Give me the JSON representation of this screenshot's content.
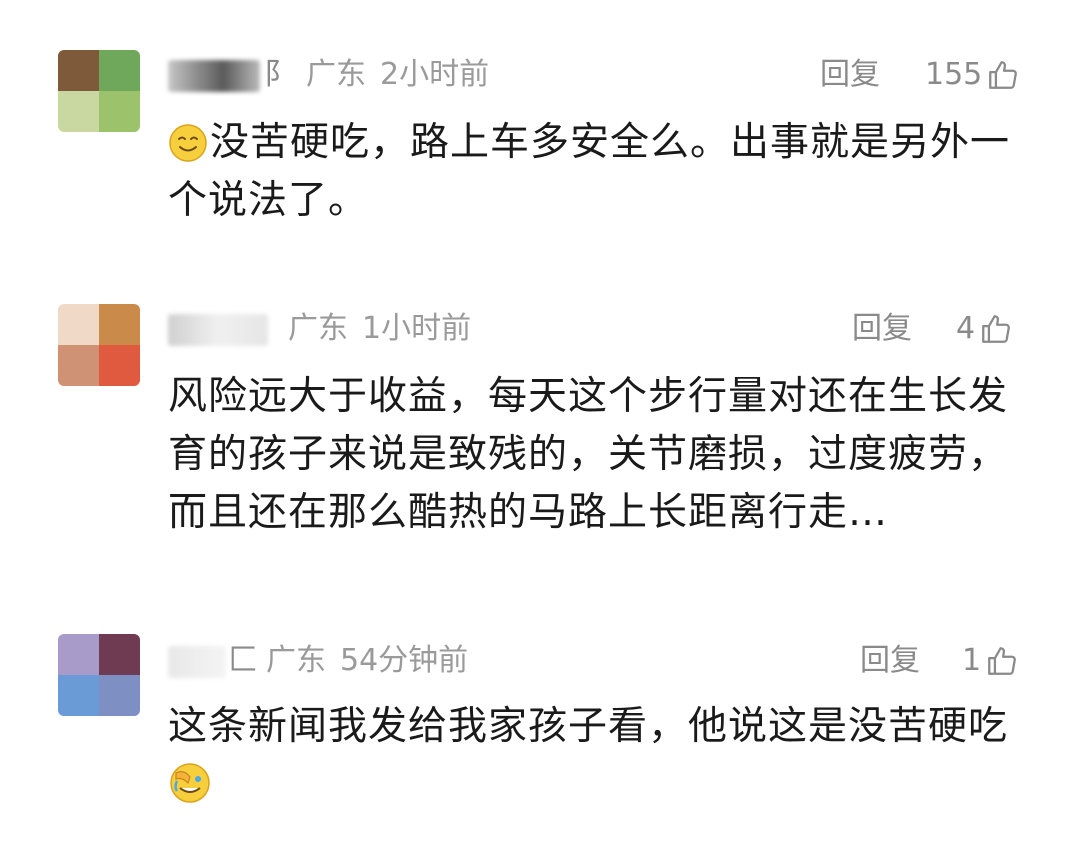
{
  "comments": [
    {
      "name_tail": "阝",
      "location": "广东",
      "time": "2小时前",
      "reply_label": "回复",
      "likes": "155",
      "text": "没苦硬吃，路上车多安全么。出事就是另外一个说法了。",
      "lead_emoji": "smile-emoji",
      "avatar_colors": [
        "#7f5a3a",
        "#6fa85a",
        "#c9d7a0",
        "#9cc36b"
      ]
    },
    {
      "name_tail": "",
      "location": "广东",
      "time": "1小时前",
      "reply_label": "回复",
      "likes": "4",
      "text": "风险远大于收益，每天这个步行量对还在生长发育的孩子来说是致残的，关节磨损，过度疲劳，而且还在那么酷热的马路上长距离行走…",
      "avatar_colors": [
        "#f1d9c8",
        "#c98a4a",
        "#cf9275",
        "#e05a3f"
      ]
    },
    {
      "name_tail": "匚",
      "location": "广东",
      "time": "54分钟前",
      "reply_label": "回复",
      "likes": "1",
      "text": "这条新闻我发给我家孩子看，他说这是没苦硬吃",
      "trail_emoji": "facepalm-cry-emoji",
      "avatar_colors": [
        "#a89ac9",
        "#6e3b52",
        "#6a9bd6",
        "#7e8fc4"
      ]
    }
  ]
}
